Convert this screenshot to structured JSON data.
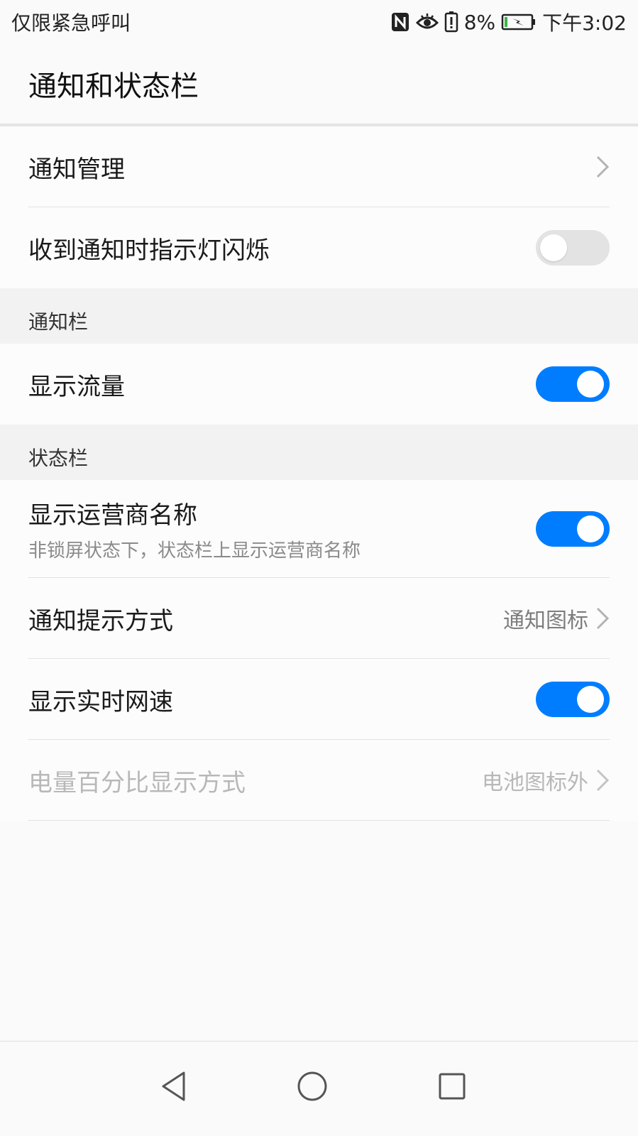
{
  "status_bar": {
    "carrier_text": "仅限紧急呼叫",
    "battery_percent": "8%",
    "time": "下午3:02",
    "icons": [
      "nfc-icon",
      "eye-comfort-icon",
      "battery-alert-icon",
      "battery-charging-icon"
    ]
  },
  "app_bar": {
    "title": "通知和状态栏"
  },
  "rows": {
    "notification_management": {
      "label": "通知管理"
    },
    "led_blink": {
      "label": "收到通知时指示灯闪烁",
      "enabled": false
    },
    "show_data_usage": {
      "label": "显示流量",
      "enabled": true
    },
    "show_carrier": {
      "label": "显示运营商名称",
      "subtitle": "非锁屏状态下，状态栏上显示运营商名称",
      "enabled": true
    },
    "notification_style": {
      "label": "通知提示方式",
      "value": "通知图标"
    },
    "network_speed": {
      "label": "显示实时网速",
      "enabled": true
    },
    "battery_percent_style": {
      "label": "电量百分比显示方式",
      "value": "电池图标外",
      "disabled": true
    }
  },
  "sections": {
    "notification_bar": "通知栏",
    "status_bar": "状态栏"
  },
  "colors": {
    "accent": "#007dff",
    "switch_off": "#e3e3e3",
    "section_bg": "#f2f2f2",
    "battery_green": "#39b54a"
  },
  "nav_bar": {
    "icons": [
      "back-icon",
      "home-icon",
      "recents-icon"
    ]
  }
}
